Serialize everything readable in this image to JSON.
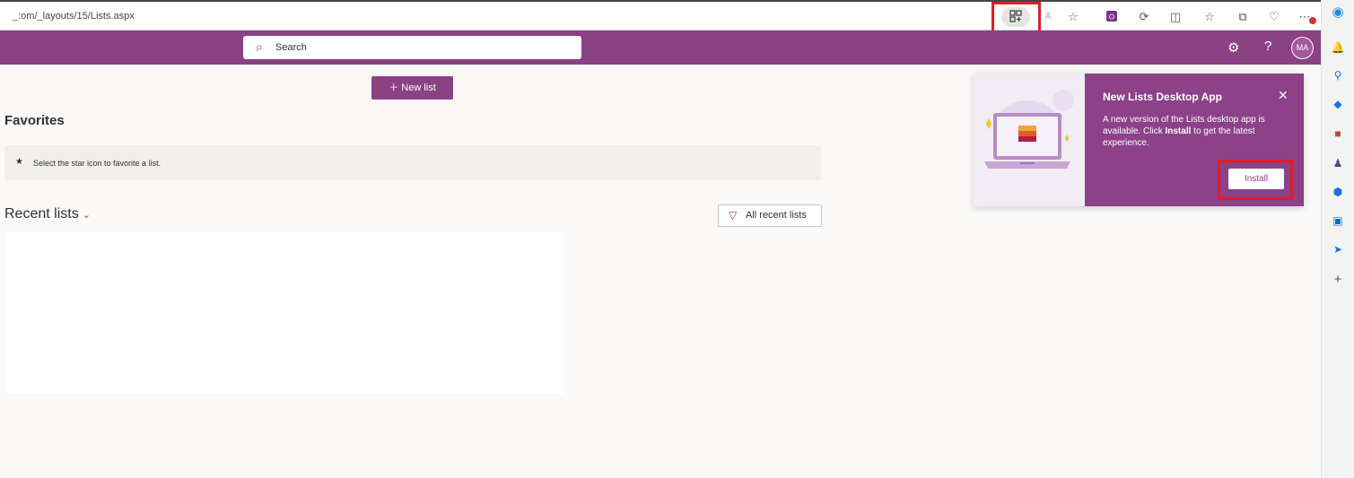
{
  "browser": {
    "address": "_:om/_layouts/15/Lists.aspx",
    "icons": [
      "app-install-icon",
      "read-aloud-icon",
      "favorite-star-icon",
      "office-extension-icon",
      "extension-icon",
      "split-screen-icon",
      "favorites-icon",
      "collections-icon",
      "browser-essentials-icon",
      "more-icon"
    ]
  },
  "sidebar": {
    "icons": [
      "copilot-icon",
      "bell-icon",
      "search-icon",
      "tag-icon",
      "briefcase-icon",
      "people-icon",
      "office-icon",
      "outlook-icon",
      "send-icon",
      "add-icon"
    ]
  },
  "suite": {
    "search_placeholder": "Search",
    "avatar_initials": "MA",
    "accent_color": "#8a4282"
  },
  "main": {
    "new_list_label": "New list",
    "favorites_heading": "Favorites",
    "favorites_hint": "Select the star icon to favorite a list.",
    "recent_heading": "Recent lists",
    "all_recent_label": "All recent lists"
  },
  "popup": {
    "title": "New Lists Desktop App",
    "body_prefix": "A new version of the Lists desktop app is available. Click ",
    "body_bold": "Install",
    "body_suffix": " to get the latest experience.",
    "install_label": "Install"
  }
}
